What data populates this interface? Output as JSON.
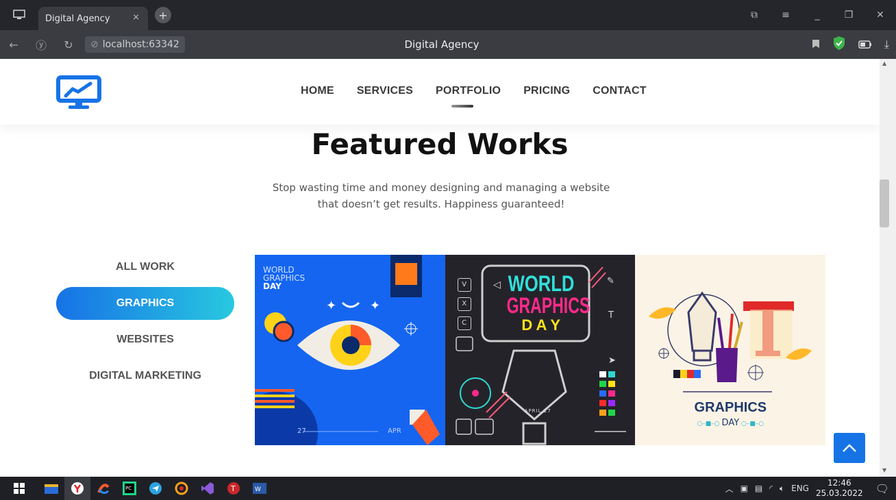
{
  "browser": {
    "tab_title": "Digital Agency",
    "tab_close": "×",
    "new_tab": "+",
    "url": "localhost:63342",
    "page_title": "Digital Agency"
  },
  "nav": {
    "items": [
      "HOME",
      "SERVICES",
      "PORTFOLIO",
      "PRICING",
      "CONTACT"
    ],
    "active": "PORTFOLIO"
  },
  "section": {
    "title": "Featured Works",
    "subtitle_line1": "Stop wasting time and money designing and managing a website",
    "subtitle_line2": "that doesn’t get results. Happiness guaranteed!"
  },
  "filters": {
    "items": [
      "ALL WORK",
      "GRAPHICS",
      "WEBSITES",
      "DIGITAL MARKETING"
    ],
    "active": "GRAPHICS"
  },
  "works": {
    "card1": {
      "line1": "WORLD",
      "line2": "GRAPHICS",
      "line3": "DAY",
      "date_left": "27",
      "date_right": "APR"
    },
    "card2": {
      "line1": "WORLD",
      "line2": "GRAPHICS",
      "line3": "D A Y",
      "btn_v": "V",
      "btn_x": "X",
      "btn_c": "C",
      "date": "APRIL 27"
    },
    "card3": {
      "line1": "GRAPHICS",
      "line2": "DAY"
    }
  },
  "taskbar": {
    "lang": "ENG",
    "time": "12:46",
    "date": "25.03.2022"
  },
  "colors": {
    "accent_blue": "#1673e6",
    "gradient_end": "#28c8e0",
    "taskbar_bg": "#1f2026"
  }
}
